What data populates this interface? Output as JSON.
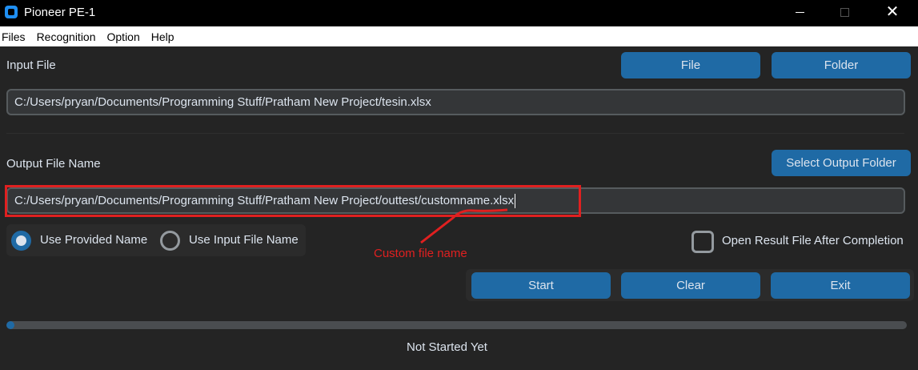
{
  "window": {
    "title": "Pioneer PE-1",
    "minimize_glyph": "—",
    "close_glyph": "✕"
  },
  "menu": [
    "Files",
    "Recognition",
    "Option",
    "Help"
  ],
  "input": {
    "label": "Input File",
    "file_button": "File",
    "folder_button": "Folder",
    "path_value": "C:/Users/pryan/Documents/Programming Stuff/Pratham New Project/tesin.xlsx"
  },
  "output": {
    "label": "Output File Name",
    "select_folder_button": "Select Output Folder",
    "path_value": "C:/Users/pryan/Documents/Programming Stuff/Pratham New Project/outtest/customname.xlsx"
  },
  "naming": {
    "option_provided": "Use Provided Name",
    "option_input": "Use Input File Name",
    "selected": "Use Provided Name"
  },
  "open_after": {
    "label": "Open Result File After Completion",
    "checked": false
  },
  "actions": {
    "start": "Start",
    "clear": "Clear",
    "exit": "Exit"
  },
  "progress": {
    "fraction": 0.008
  },
  "status": "Not Started Yet",
  "annotation": {
    "text": "Custom file name",
    "color": "#e02020"
  },
  "colors": {
    "accent": "#1f6aa5",
    "background": "#242424",
    "entry_bg": "#343638"
  }
}
